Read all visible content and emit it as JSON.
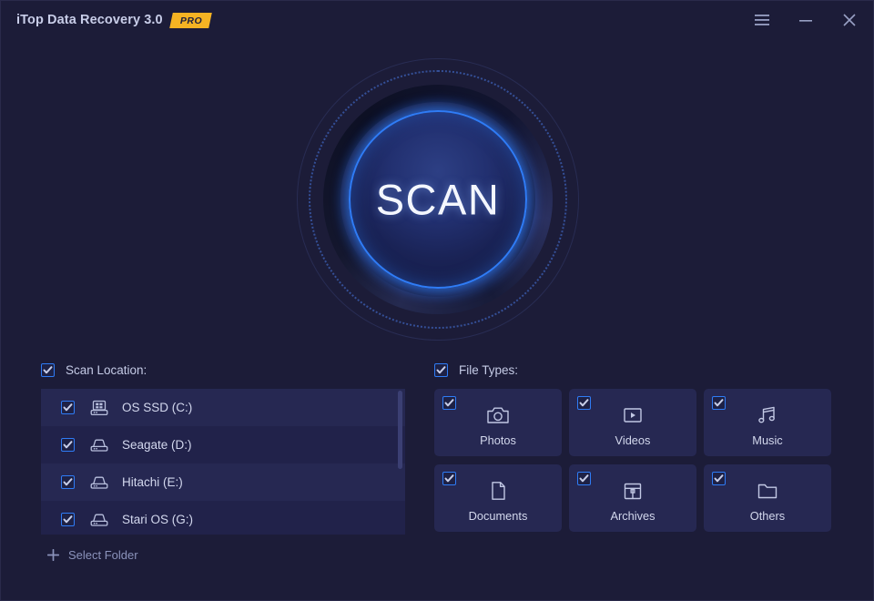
{
  "window": {
    "title": "iTop Data Recovery 3.0",
    "pro_badge": "PRO",
    "background_color": "#1c1c38",
    "accent_color": "#2f7cf6",
    "badge_color": "#f5b323"
  },
  "titlebar_controls": [
    {
      "name": "menu-button",
      "icon": "hamburger-menu-icon"
    },
    {
      "name": "minimize-button",
      "icon": "minimize-icon"
    },
    {
      "name": "close-button",
      "icon": "close-icon"
    }
  ],
  "scan": {
    "label": "SCAN"
  },
  "scan_location": {
    "header_label": "Scan Location:",
    "header_checked": true,
    "drives": [
      {
        "name": "OS SSD (C:)",
        "icon": "ssd-drive-icon",
        "checked": true
      },
      {
        "name": "Seagate (D:)",
        "icon": "hard-drive-icon",
        "checked": true
      },
      {
        "name": "Hitachi (E:)",
        "icon": "hard-drive-icon",
        "checked": true
      },
      {
        "name": "Stari OS (G:)",
        "icon": "hard-drive-icon",
        "checked": true
      }
    ],
    "select_folder_label": "Select Folder"
  },
  "file_types": {
    "header_label": "File Types:",
    "header_checked": true,
    "items": [
      {
        "label": "Photos",
        "icon": "camera-icon",
        "checked": true
      },
      {
        "label": "Videos",
        "icon": "video-icon",
        "checked": true
      },
      {
        "label": "Music",
        "icon": "music-note-icon",
        "checked": true
      },
      {
        "label": "Documents",
        "icon": "document-icon",
        "checked": true
      },
      {
        "label": "Archives",
        "icon": "archive-box-icon",
        "checked": true
      },
      {
        "label": "Others",
        "icon": "folder-icon",
        "checked": true
      }
    ]
  }
}
